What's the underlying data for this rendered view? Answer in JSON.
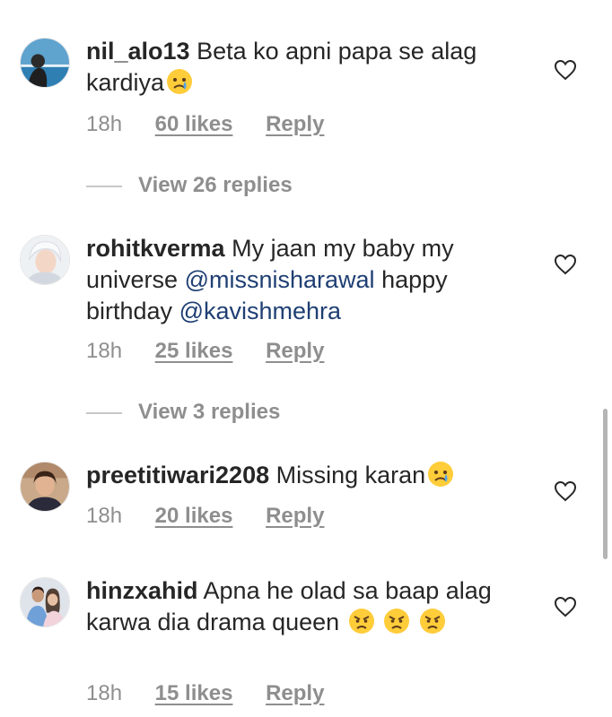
{
  "comments": [
    {
      "username": "nil_alo13",
      "text": "Beta ko apni papa se alag kardiya",
      "emoji": "crying-face",
      "time": "18h",
      "likes": "60 likes",
      "reply": "Reply",
      "view_replies": "View 26 replies"
    },
    {
      "username": "rohitkverma",
      "text_before": "My jaan my baby my universe",
      "mention1": "@missnisharawal",
      "text_middle": "happy birthday",
      "mention2": "@kavishmehra",
      "time": "18h",
      "likes": "25 likes",
      "reply": "Reply",
      "view_replies": "View 3 replies"
    },
    {
      "username": "preetitiwari2208",
      "text": "Missing karan",
      "emoji": "crying-face",
      "time": "18h",
      "likes": "20 likes",
      "reply": "Reply"
    },
    {
      "username": "hinzxahid",
      "text": "Apna he olad sa baap alag karwa dia drama queen",
      "emoji": "angry-face",
      "time": "18h",
      "likes": "15 likes",
      "reply": "Reply"
    }
  ],
  "colors": {
    "text": "#262626",
    "secondary": "#8e8e8e",
    "mention": "#1f3f73"
  }
}
